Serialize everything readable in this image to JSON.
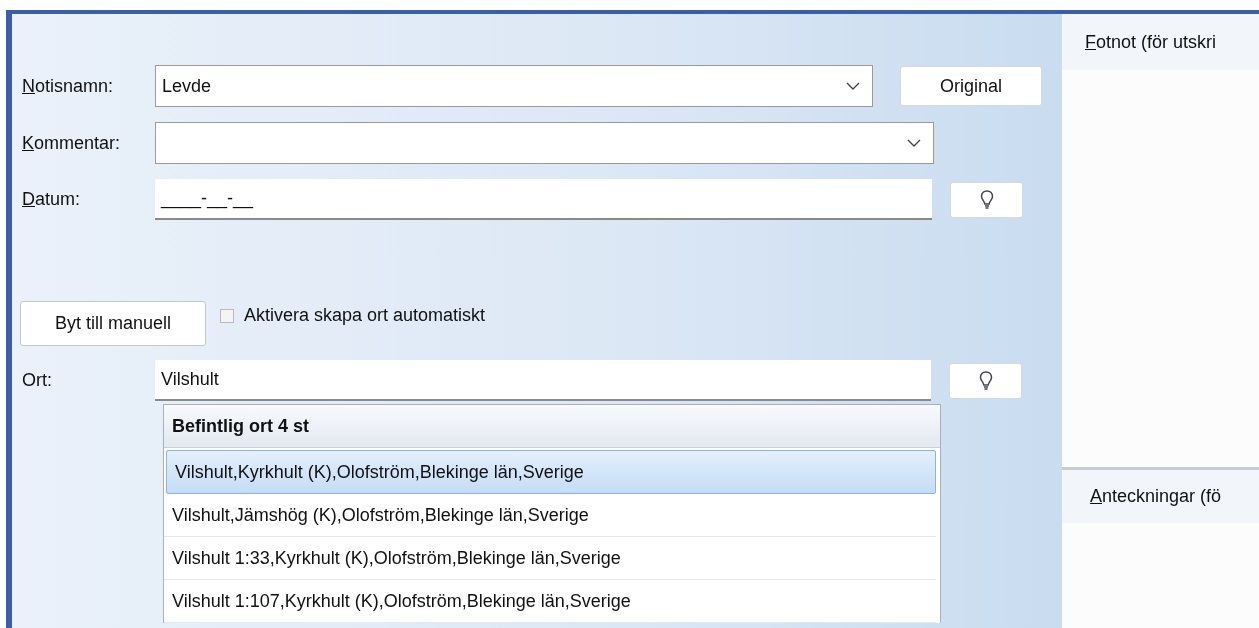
{
  "fields": [
    {
      "label": "Notisnamn:",
      "mnemonic": true,
      "kind": "combo",
      "value": "Levde",
      "button": {
        "kind": "text",
        "label": "Original"
      }
    },
    {
      "label": "Kommentar:",
      "mnemonic": true,
      "kind": "combo"
    },
    {
      "label": "Datum:",
      "mnemonic": true,
      "kind": "text",
      "value": "____-__-__",
      "button": {
        "kind": "hint"
      }
    }
  ],
  "manual_button": "Byt till manuell",
  "auto_checkbox": {
    "label": "Aktivera skapa ort automatiskt",
    "checked": false
  },
  "place_field": {
    "label": "Ort:",
    "mnemonic": false,
    "kind": "text",
    "value": "Vilshult",
    "button": {
      "kind": "hint"
    }
  },
  "place_list": {
    "header": "Befintlig ort 4 st",
    "rows": [
      {
        "text": "Vilshult,Kyrkhult (K),Olofström,Blekinge län,Sverige",
        "selected": true
      },
      {
        "text": "Vilshult,Jämshög (K),Olofström,Blekinge län,Sverige",
        "selected": false
      },
      {
        "text": "Vilshult 1:33,Kyrkhult (K),Olofström,Blekinge län,Sverige",
        "selected": false
      },
      {
        "text": "Vilshult 1:107,Kyrkhult (K),Olofström,Blekinge län,Sverige",
        "selected": false
      }
    ]
  },
  "side_panel": {
    "sections": [
      {
        "header": "Fotnot (för utskri",
        "mnemonic": true
      },
      {
        "header": "Anteckningar (fö",
        "mnemonic": true
      }
    ]
  }
}
